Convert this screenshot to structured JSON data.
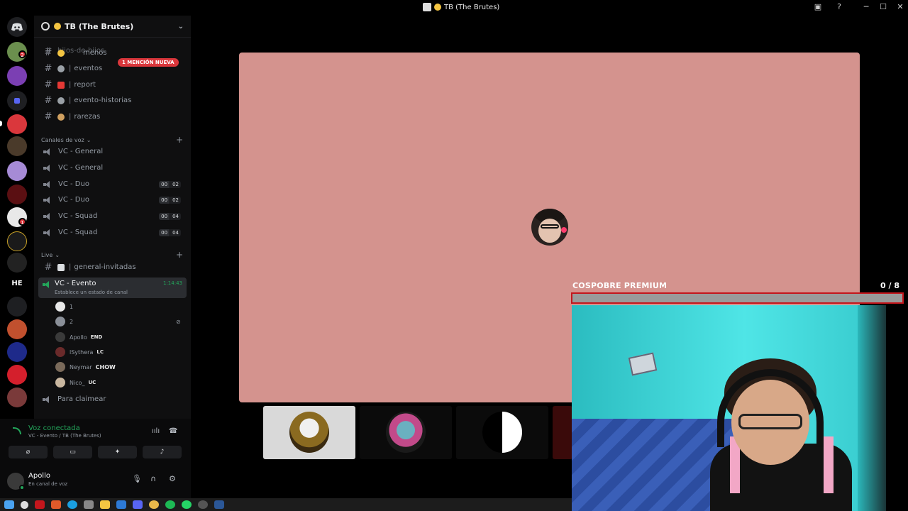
{
  "window": {
    "title": "TB (The Brutes)",
    "min_label": "─",
    "max_label": "☐",
    "close_label": "✕"
  },
  "server": {
    "name": "TB (The Brutes)",
    "mention_badge": "1 MENCIÓN NUEVA",
    "rail_badges": [
      "2",
      "1"
    ],
    "rail_text_item": "HE"
  },
  "channels": {
    "top_partial": "hijos-de-hijos",
    "partial": "menos",
    "items": [
      {
        "name": "eventos",
        "prefix": "|"
      },
      {
        "name": "report",
        "prefix": "|"
      },
      {
        "name": "evento-historias",
        "prefix": "|"
      },
      {
        "name": "rarezas",
        "prefix": "|"
      }
    ],
    "voice_category": "Canales de voz",
    "voice": [
      {
        "name": "VC - General",
        "c1": "",
        "c2": ""
      },
      {
        "name": "VC - General",
        "c1": "",
        "c2": ""
      },
      {
        "name": "VC - Duo",
        "c1": "00",
        "c2": "02"
      },
      {
        "name": "VC - Duo",
        "c1": "00",
        "c2": "02"
      },
      {
        "name": "VC - Squad",
        "c1": "00",
        "c2": "04"
      },
      {
        "name": "VC - Squad",
        "c1": "00",
        "c2": "04"
      }
    ],
    "live_category": "Live",
    "live_text_channel": "general-invitadas",
    "active_voice": {
      "name": "VC - Evento",
      "status": "Establece un estado de canal",
      "timer": "1:14:43"
    },
    "members": [
      {
        "name": "1",
        "tag": ""
      },
      {
        "name": "2",
        "tag": ""
      },
      {
        "name": "Apollo",
        "tag": "END"
      },
      {
        "name": "lSythera",
        "tag": "LC"
      },
      {
        "name": "Neymar",
        "tag": "CHOW"
      },
      {
        "name": "Nico_",
        "tag": "UC"
      }
    ],
    "claim": "Para claimear"
  },
  "voice_panel": {
    "connected": "Voz conectada",
    "channel": "VC - Evento / TB (The Brutes)"
  },
  "user": {
    "name": "Apollo",
    "status": "En canal de voz"
  },
  "overlay": {
    "label": "COSPOBRE PREMIUM",
    "count": "0  / 8",
    "progress": 0
  },
  "colors": {
    "accent": "#23a55a",
    "mention": "#da373c",
    "stage_bg": "#d4938e",
    "progress_border": "#c4161c"
  }
}
